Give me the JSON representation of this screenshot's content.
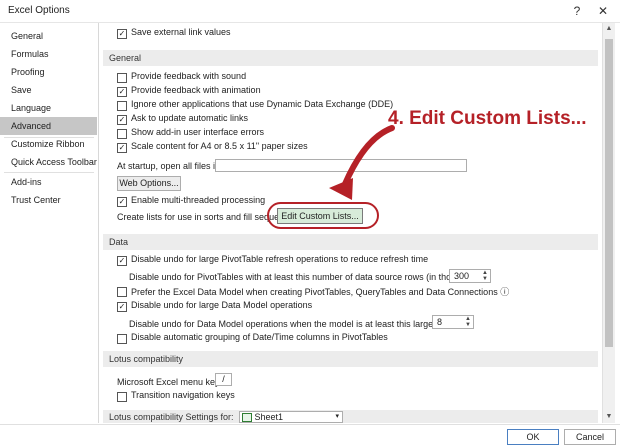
{
  "window": {
    "title": "Excel Options",
    "help_label": "?",
    "close_label": "✕"
  },
  "sidebar": {
    "items": [
      {
        "label": "General"
      },
      {
        "label": "Formulas"
      },
      {
        "label": "Proofing"
      },
      {
        "label": "Save"
      },
      {
        "label": "Language"
      },
      {
        "label": "Advanced",
        "selected": true
      },
      {
        "label": "Customize Ribbon"
      },
      {
        "label": "Quick Access Toolbar"
      },
      {
        "label": "Add-ins"
      },
      {
        "label": "Trust Center"
      }
    ]
  },
  "top_row": {
    "label": "Save external link values",
    "checked": true
  },
  "general": {
    "header": "General",
    "options": [
      {
        "label": "Provide feedback with sound",
        "checked": false
      },
      {
        "label": "Provide feedback with animation",
        "checked": true
      },
      {
        "label": "Ignore other applications that use Dynamic Data Exchange (DDE)",
        "checked": false
      },
      {
        "label": "Ask to update automatic links",
        "checked": true
      },
      {
        "label": "Show add-in user interface errors",
        "checked": false
      },
      {
        "label": "Scale content for A4 or 8.5 x 11\" paper sizes",
        "checked": true
      }
    ],
    "startup_label": "At startup, open all files in:",
    "startup_value": "",
    "web_options_label": "Web Options...",
    "multithread_label": "Enable multi-threaded processing",
    "multithread_checked": true,
    "custom_lists_text": "Create lists for use in sorts and fill sequences:",
    "custom_lists_button": "Edit Custom Lists..."
  },
  "data": {
    "header": "Data",
    "opt1": {
      "label": "Disable undo for large PivotTable refresh operations to reduce refresh time",
      "checked": true
    },
    "rows_label": "Disable undo for PivotTables with at least this number of data source rows (in thousands):",
    "rows_value": "300",
    "opt2": {
      "label": "Prefer the Excel Data Model when creating PivotTables, QueryTables and Data Connections",
      "checked": false
    },
    "info_icon": "ⓘ",
    "opt3": {
      "label": "Disable undo for large Data Model operations",
      "checked": true
    },
    "mb_label": "Disable undo for Data Model operations when the model is at least this large (in MB):",
    "mb_value": "8",
    "opt4": {
      "label": "Disable automatic grouping of Date/Time columns in PivotTables",
      "checked": false
    }
  },
  "lotus": {
    "header": "Lotus compatibility",
    "menu_key_label": "Microsoft Excel menu key:",
    "menu_key_value": "/",
    "transition_label": "Transition navigation keys",
    "transition_checked": false,
    "settings_label": "Lotus compatibility Settings for:",
    "sheet_value": "Sheet1"
  },
  "footer": {
    "ok_label": "OK",
    "cancel_label": "Cancel"
  },
  "annotation": {
    "text": "4. Edit Custom Lists...",
    "color": "#b52127"
  }
}
